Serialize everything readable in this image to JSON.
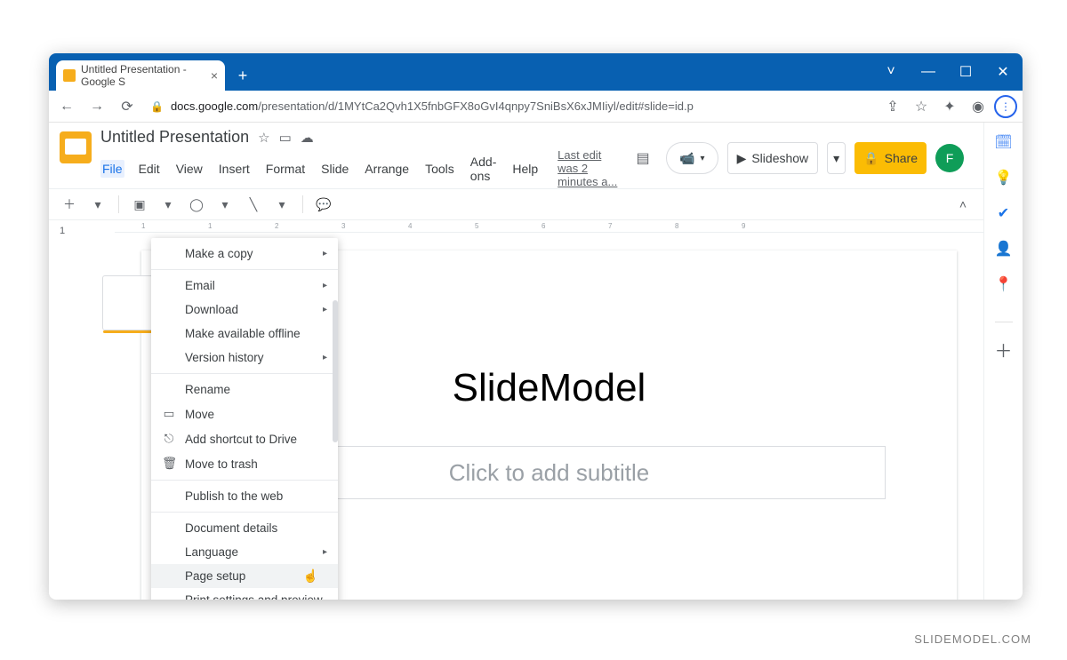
{
  "browser": {
    "tab_title": "Untitled Presentation - Google S",
    "url_host": "docs.google.com",
    "url_path": "/presentation/d/1MYtCa2Qvh1X5fnbGFX8oGvI4qnpy7SniBsX6xJMIiyl/edit#slide=id.p"
  },
  "doc": {
    "title": "Untitled Presentation",
    "last_edit": "Last edit was 2 minutes a...",
    "avatar_initial": "F"
  },
  "menus": [
    "File",
    "Edit",
    "View",
    "Insert",
    "Format",
    "Slide",
    "Arrange",
    "Tools",
    "Add-ons",
    "Help"
  ],
  "header_buttons": {
    "slideshow": "Slideshow",
    "share": "Share"
  },
  "ruler_ticks": [
    "1",
    "1",
    "2",
    "3",
    "4",
    "5",
    "6",
    "7",
    "8",
    "9"
  ],
  "slide": {
    "title": "SlideModel",
    "subtitle_placeholder": "Click to add subtitle"
  },
  "file_menu": [
    {
      "label": "Make a copy",
      "submenu": true
    },
    {
      "sep": true
    },
    {
      "label": "Email",
      "submenu": true
    },
    {
      "label": "Download",
      "submenu": true
    },
    {
      "label": "Make available offline"
    },
    {
      "label": "Version history",
      "submenu": true
    },
    {
      "sep": true
    },
    {
      "label": "Rename"
    },
    {
      "label": "Move",
      "icon": "folder"
    },
    {
      "label": "Add shortcut to Drive",
      "icon": "shortcut"
    },
    {
      "label": "Move to trash",
      "icon": "trash"
    },
    {
      "sep": true
    },
    {
      "label": "Publish to the web"
    },
    {
      "sep": true
    },
    {
      "label": "Document details"
    },
    {
      "label": "Language",
      "submenu": true
    },
    {
      "label": "Page setup",
      "hover": true
    },
    {
      "label": "Print settings and preview"
    }
  ],
  "thumb_number": "1",
  "brand": "SLIDEMODEL.COM"
}
